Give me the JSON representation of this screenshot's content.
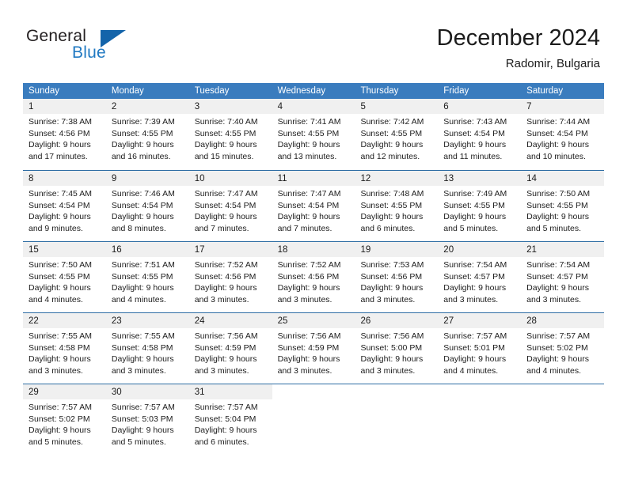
{
  "brand": {
    "name_part1": "General",
    "name_part2": "Blue",
    "triangle_color": "#1464aa",
    "blue_text_color": "#2079c2"
  },
  "header": {
    "title": "December 2024",
    "location": "Radomir, Bulgaria"
  },
  "theme": {
    "header_band": "#3a7cbe",
    "week_separator": "#2e6da4",
    "day_number_band": "#f0f0f0",
    "text": "#1c1c1c"
  },
  "weekdays": [
    "Sunday",
    "Monday",
    "Tuesday",
    "Wednesday",
    "Thursday",
    "Friday",
    "Saturday"
  ],
  "weeks": [
    [
      {
        "day": "1",
        "sunrise": "Sunrise: 7:38 AM",
        "sunset": "Sunset: 4:56 PM",
        "daylight1": "Daylight: 9 hours",
        "daylight2": "and 17 minutes."
      },
      {
        "day": "2",
        "sunrise": "Sunrise: 7:39 AM",
        "sunset": "Sunset: 4:55 PM",
        "daylight1": "Daylight: 9 hours",
        "daylight2": "and 16 minutes."
      },
      {
        "day": "3",
        "sunrise": "Sunrise: 7:40 AM",
        "sunset": "Sunset: 4:55 PM",
        "daylight1": "Daylight: 9 hours",
        "daylight2": "and 15 minutes."
      },
      {
        "day": "4",
        "sunrise": "Sunrise: 7:41 AM",
        "sunset": "Sunset: 4:55 PM",
        "daylight1": "Daylight: 9 hours",
        "daylight2": "and 13 minutes."
      },
      {
        "day": "5",
        "sunrise": "Sunrise: 7:42 AM",
        "sunset": "Sunset: 4:55 PM",
        "daylight1": "Daylight: 9 hours",
        "daylight2": "and 12 minutes."
      },
      {
        "day": "6",
        "sunrise": "Sunrise: 7:43 AM",
        "sunset": "Sunset: 4:54 PM",
        "daylight1": "Daylight: 9 hours",
        "daylight2": "and 11 minutes."
      },
      {
        "day": "7",
        "sunrise": "Sunrise: 7:44 AM",
        "sunset": "Sunset: 4:54 PM",
        "daylight1": "Daylight: 9 hours",
        "daylight2": "and 10 minutes."
      }
    ],
    [
      {
        "day": "8",
        "sunrise": "Sunrise: 7:45 AM",
        "sunset": "Sunset: 4:54 PM",
        "daylight1": "Daylight: 9 hours",
        "daylight2": "and 9 minutes."
      },
      {
        "day": "9",
        "sunrise": "Sunrise: 7:46 AM",
        "sunset": "Sunset: 4:54 PM",
        "daylight1": "Daylight: 9 hours",
        "daylight2": "and 8 minutes."
      },
      {
        "day": "10",
        "sunrise": "Sunrise: 7:47 AM",
        "sunset": "Sunset: 4:54 PM",
        "daylight1": "Daylight: 9 hours",
        "daylight2": "and 7 minutes."
      },
      {
        "day": "11",
        "sunrise": "Sunrise: 7:47 AM",
        "sunset": "Sunset: 4:54 PM",
        "daylight1": "Daylight: 9 hours",
        "daylight2": "and 7 minutes."
      },
      {
        "day": "12",
        "sunrise": "Sunrise: 7:48 AM",
        "sunset": "Sunset: 4:55 PM",
        "daylight1": "Daylight: 9 hours",
        "daylight2": "and 6 minutes."
      },
      {
        "day": "13",
        "sunrise": "Sunrise: 7:49 AM",
        "sunset": "Sunset: 4:55 PM",
        "daylight1": "Daylight: 9 hours",
        "daylight2": "and 5 minutes."
      },
      {
        "day": "14",
        "sunrise": "Sunrise: 7:50 AM",
        "sunset": "Sunset: 4:55 PM",
        "daylight1": "Daylight: 9 hours",
        "daylight2": "and 5 minutes."
      }
    ],
    [
      {
        "day": "15",
        "sunrise": "Sunrise: 7:50 AM",
        "sunset": "Sunset: 4:55 PM",
        "daylight1": "Daylight: 9 hours",
        "daylight2": "and 4 minutes."
      },
      {
        "day": "16",
        "sunrise": "Sunrise: 7:51 AM",
        "sunset": "Sunset: 4:55 PM",
        "daylight1": "Daylight: 9 hours",
        "daylight2": "and 4 minutes."
      },
      {
        "day": "17",
        "sunrise": "Sunrise: 7:52 AM",
        "sunset": "Sunset: 4:56 PM",
        "daylight1": "Daylight: 9 hours",
        "daylight2": "and 3 minutes."
      },
      {
        "day": "18",
        "sunrise": "Sunrise: 7:52 AM",
        "sunset": "Sunset: 4:56 PM",
        "daylight1": "Daylight: 9 hours",
        "daylight2": "and 3 minutes."
      },
      {
        "day": "19",
        "sunrise": "Sunrise: 7:53 AM",
        "sunset": "Sunset: 4:56 PM",
        "daylight1": "Daylight: 9 hours",
        "daylight2": "and 3 minutes."
      },
      {
        "day": "20",
        "sunrise": "Sunrise: 7:54 AM",
        "sunset": "Sunset: 4:57 PM",
        "daylight1": "Daylight: 9 hours",
        "daylight2": "and 3 minutes."
      },
      {
        "day": "21",
        "sunrise": "Sunrise: 7:54 AM",
        "sunset": "Sunset: 4:57 PM",
        "daylight1": "Daylight: 9 hours",
        "daylight2": "and 3 minutes."
      }
    ],
    [
      {
        "day": "22",
        "sunrise": "Sunrise: 7:55 AM",
        "sunset": "Sunset: 4:58 PM",
        "daylight1": "Daylight: 9 hours",
        "daylight2": "and 3 minutes."
      },
      {
        "day": "23",
        "sunrise": "Sunrise: 7:55 AM",
        "sunset": "Sunset: 4:58 PM",
        "daylight1": "Daylight: 9 hours",
        "daylight2": "and 3 minutes."
      },
      {
        "day": "24",
        "sunrise": "Sunrise: 7:56 AM",
        "sunset": "Sunset: 4:59 PM",
        "daylight1": "Daylight: 9 hours",
        "daylight2": "and 3 minutes."
      },
      {
        "day": "25",
        "sunrise": "Sunrise: 7:56 AM",
        "sunset": "Sunset: 4:59 PM",
        "daylight1": "Daylight: 9 hours",
        "daylight2": "and 3 minutes."
      },
      {
        "day": "26",
        "sunrise": "Sunrise: 7:56 AM",
        "sunset": "Sunset: 5:00 PM",
        "daylight1": "Daylight: 9 hours",
        "daylight2": "and 3 minutes."
      },
      {
        "day": "27",
        "sunrise": "Sunrise: 7:57 AM",
        "sunset": "Sunset: 5:01 PM",
        "daylight1": "Daylight: 9 hours",
        "daylight2": "and 4 minutes."
      },
      {
        "day": "28",
        "sunrise": "Sunrise: 7:57 AM",
        "sunset": "Sunset: 5:02 PM",
        "daylight1": "Daylight: 9 hours",
        "daylight2": "and 4 minutes."
      }
    ],
    [
      {
        "day": "29",
        "sunrise": "Sunrise: 7:57 AM",
        "sunset": "Sunset: 5:02 PM",
        "daylight1": "Daylight: 9 hours",
        "daylight2": "and 5 minutes."
      },
      {
        "day": "30",
        "sunrise": "Sunrise: 7:57 AM",
        "sunset": "Sunset: 5:03 PM",
        "daylight1": "Daylight: 9 hours",
        "daylight2": "and 5 minutes."
      },
      {
        "day": "31",
        "sunrise": "Sunrise: 7:57 AM",
        "sunset": "Sunset: 5:04 PM",
        "daylight1": "Daylight: 9 hours",
        "daylight2": "and 6 minutes."
      },
      {
        "day": "",
        "sunrise": "",
        "sunset": "",
        "daylight1": "",
        "daylight2": ""
      },
      {
        "day": "",
        "sunrise": "",
        "sunset": "",
        "daylight1": "",
        "daylight2": ""
      },
      {
        "day": "",
        "sunrise": "",
        "sunset": "",
        "daylight1": "",
        "daylight2": ""
      },
      {
        "day": "",
        "sunrise": "",
        "sunset": "",
        "daylight1": "",
        "daylight2": ""
      }
    ]
  ]
}
